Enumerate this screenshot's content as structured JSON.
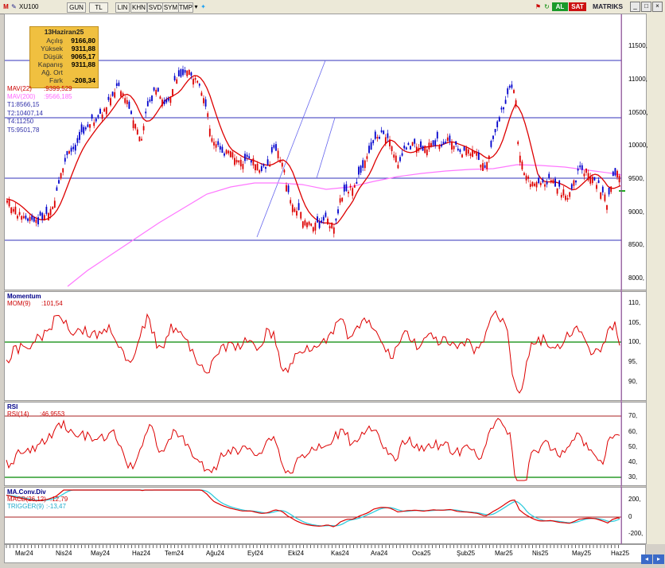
{
  "toolbar": {
    "symbol": "XU100",
    "buttons": [
      "GUN",
      "TL",
      "LIN",
      "KHN",
      "SVD",
      "SYM",
      "TMP"
    ],
    "al_label": "AL",
    "sat_label": "SAT",
    "brand": "MATRIKS"
  },
  "info_box": {
    "date": "13Haziran25",
    "rows": [
      {
        "k": "Açılış",
        "v": "9166,80"
      },
      {
        "k": "Yüksek",
        "v": "9311,88"
      },
      {
        "k": "Düşük",
        "v": "9065,17"
      },
      {
        "k": "Kapanış",
        "v": "9311,88"
      },
      {
        "k": "Ağ. Ort",
        "v": ""
      },
      {
        "k": "Fark",
        "v": "-208,34"
      }
    ]
  },
  "price_panel": {
    "labels": [
      {
        "text": "MAV(22)",
        "value": ":9399,529",
        "color": "#cc0000"
      },
      {
        "text": "MAV(200)",
        "value": ":9566,185",
        "color": "#ff66ff"
      },
      {
        "text": "T1:8566,15",
        "value": "",
        "color": "#3333aa"
      },
      {
        "text": "T2:10407,14",
        "value": "",
        "color": "#3333aa"
      },
      {
        "text": "T4:11250",
        "value": "",
        "color": "#3333aa"
      },
      {
        "text": "T5:9501,78",
        "value": "",
        "color": "#3333aa"
      }
    ],
    "yticks": [
      "11500,",
      "11000,",
      "10500,",
      "10000,",
      "9500,",
      "9000,",
      "8500,",
      "8000,"
    ]
  },
  "momentum_panel": {
    "title": "Momentum",
    "label": "MOM(9)",
    "value": ":101,54",
    "yticks": [
      "110,",
      "105,",
      "100,",
      "95,",
      "90,"
    ]
  },
  "rsi_panel": {
    "title": "RSI",
    "label": "RSI(14)",
    "value": ":46,9553",
    "yticks": [
      "70,",
      "60,",
      "50,",
      "40,",
      "30,"
    ]
  },
  "macd_panel": {
    "title": "MA.Conv.Div",
    "label": "MACD(26,12)",
    "value": ":12,79",
    "trigger_label": "TRIGGER(9)",
    "trigger_value": ":-13,47",
    "yticks": [
      "200,",
      "0",
      "-200,"
    ]
  },
  "xaxis": [
    "Mar24",
    "Nis24",
    "May24",
    "Haz24",
    "Tem24",
    "Ağu24",
    "Eyl24",
    "Eki24",
    "Kas24",
    "Ara24",
    "Oca25",
    "Şub25",
    "Mar25",
    "Nis25",
    "May25",
    "Haz25"
  ],
  "colors": {
    "up": "#0000cc",
    "down": "#dd0000",
    "ma22": "#dd0000",
    "ma200": "#ff77ff",
    "hline": "#3333bb",
    "green": "#008800",
    "macd": "#dd0000",
    "trigger": "#33ccdd"
  }
}
